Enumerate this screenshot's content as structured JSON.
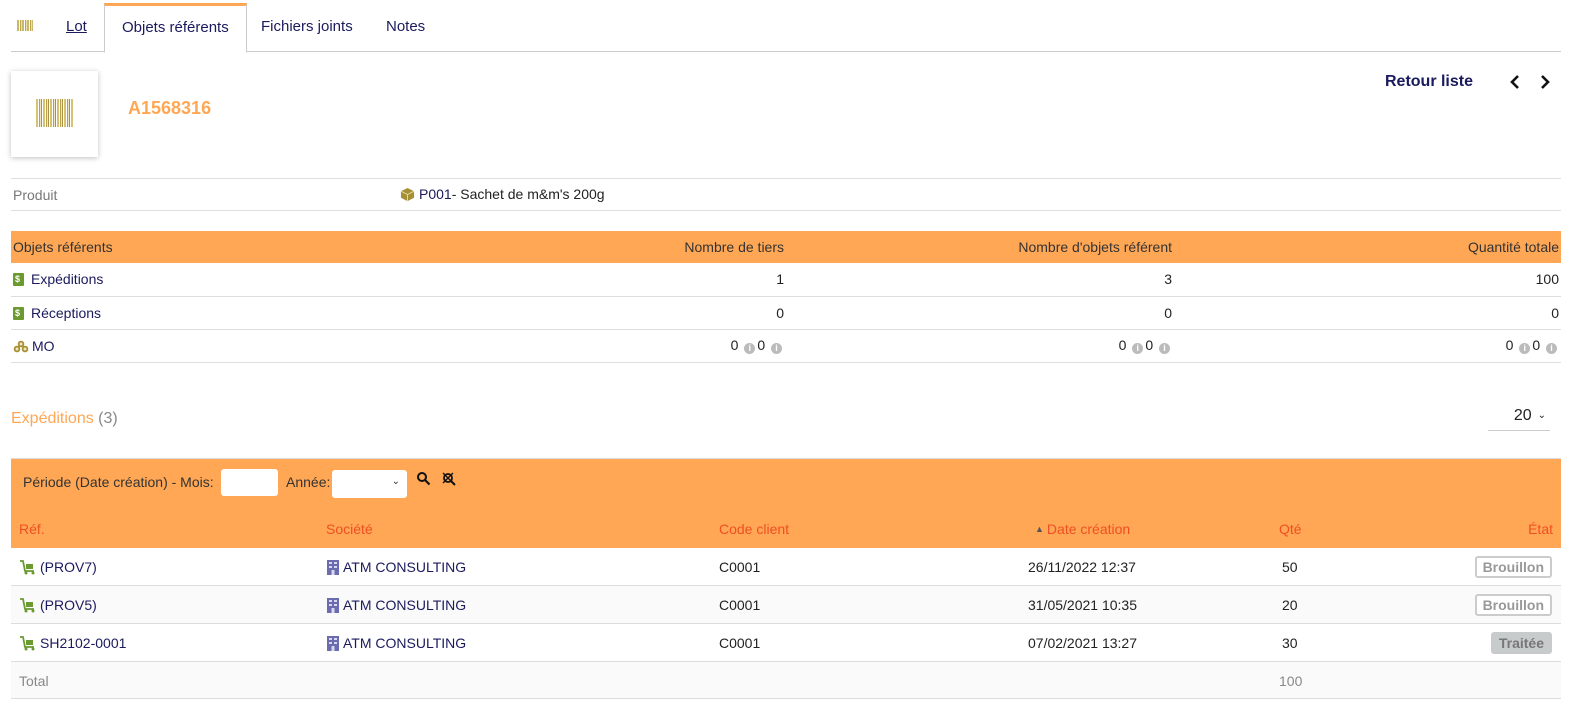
{
  "tabs": [
    {
      "label": "",
      "icon": "barcode-icon"
    },
    {
      "label": "Lot"
    },
    {
      "label": "Objets référents",
      "active": true
    },
    {
      "label": "Fichiers joints"
    },
    {
      "label": "Notes"
    }
  ],
  "header": {
    "ref": "A1568316",
    "back_label": "Retour liste",
    "prev_icon": "chevron-left-icon",
    "next_icon": "chevron-right-icon"
  },
  "product": {
    "label": "Produit",
    "ref": "P001",
    "name": " - Sachet de m&m's 200g"
  },
  "summary": {
    "headers": [
      "Objets référents",
      "Nombre de tiers",
      "Nombre d'objets référent",
      "Quantité totale"
    ],
    "rows": [
      {
        "name": "Expéditions",
        "icon": "bill-icon",
        "tiers": "1",
        "objets": "3",
        "qty": "100"
      },
      {
        "name": "Réceptions",
        "icon": "bill-icon",
        "tiers": "0",
        "objets": "0",
        "qty": "0"
      },
      {
        "name": "MO",
        "icon": "mrp-icon",
        "tiers": [
          "0",
          "0"
        ],
        "objets": [
          "0",
          "0"
        ],
        "qty": [
          "0",
          "0"
        ]
      }
    ]
  },
  "expeditions": {
    "title": "Expéditions",
    "count": "(3)",
    "limit": "20",
    "filter": {
      "period_label": "Période (Date création) - Mois:",
      "month_value": "",
      "year_label": "Année:",
      "year_value": ""
    },
    "columns": [
      "Réf.",
      "Société",
      "Code client",
      "Date création",
      "Qté",
      "État"
    ],
    "sort_column": "Date création",
    "rows": [
      {
        "ref": "(PROV7)",
        "company": "ATM CONSULTING",
        "client_code": "C0001",
        "date": "26/11/2022 12:37",
        "qty": "50",
        "status": "Brouillon",
        "status_type": "draft"
      },
      {
        "ref": "(PROV5)",
        "company": "ATM CONSULTING",
        "client_code": "C0001",
        "date": "31/05/2021 10:35",
        "qty": "20",
        "status": "Brouillon",
        "status_type": "draft"
      },
      {
        "ref": "SH2102-0001",
        "company": "ATM CONSULTING",
        "client_code": "C0001",
        "date": "07/02/2021 13:27",
        "qty": "30",
        "status": "Traitée",
        "status_type": "done"
      }
    ],
    "total_label": "Total",
    "total_qty": "100"
  },
  "colors": {
    "accent": "#ffa754",
    "link": "#1a1a5e",
    "header_text": "#f04e23"
  }
}
